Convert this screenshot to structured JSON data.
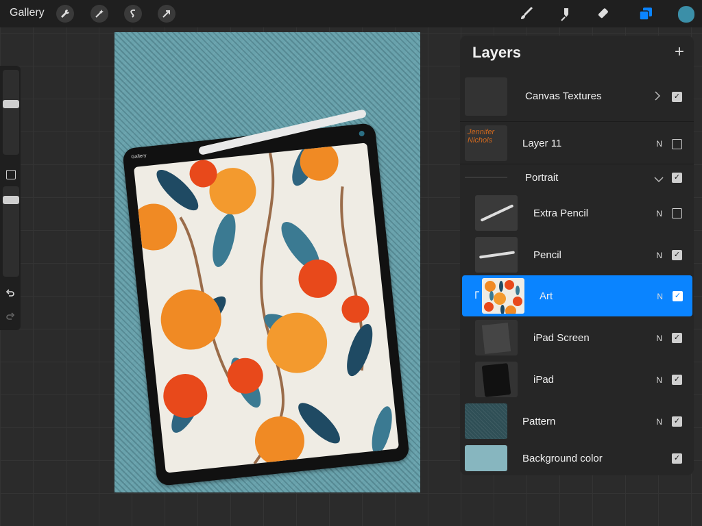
{
  "topbar": {
    "gallery_label": "Gallery",
    "left_tools": [
      "wrench-icon",
      "magic-wand-icon",
      "selection-icon",
      "transform-arrow-icon"
    ],
    "right_tools": [
      "brush-icon",
      "smudge-icon",
      "eraser-icon",
      "layers-icon"
    ],
    "color": "#3b8fa8"
  },
  "canvas": {
    "background": "#69a2ac",
    "inner_ui_label": "Gallery"
  },
  "layers_panel": {
    "title": "Layers",
    "add_glyph": "+",
    "layers": [
      {
        "name": "Canvas Textures",
        "blend": "",
        "checked": true,
        "group": true
      },
      {
        "name": "Layer 11",
        "blend": "N",
        "checked": false
      },
      {
        "name": "Portrait",
        "blend": "",
        "checked": true,
        "group": true
      },
      {
        "name": "Extra Pencil",
        "blend": "N",
        "checked": false
      },
      {
        "name": "Pencil",
        "blend": "N",
        "checked": true
      },
      {
        "name": "Art",
        "blend": "N",
        "checked": true,
        "selected": true
      },
      {
        "name": "iPad Screen",
        "blend": "N",
        "checked": true
      },
      {
        "name": "iPad",
        "blend": "N",
        "checked": true
      },
      {
        "name": "Pattern",
        "blend": "N",
        "checked": true
      },
      {
        "name": "Background color",
        "blend": "",
        "checked": true
      }
    ],
    "layer11_thumb_text": "Jennifer Nichols",
    "accent": "#0a84ff"
  }
}
